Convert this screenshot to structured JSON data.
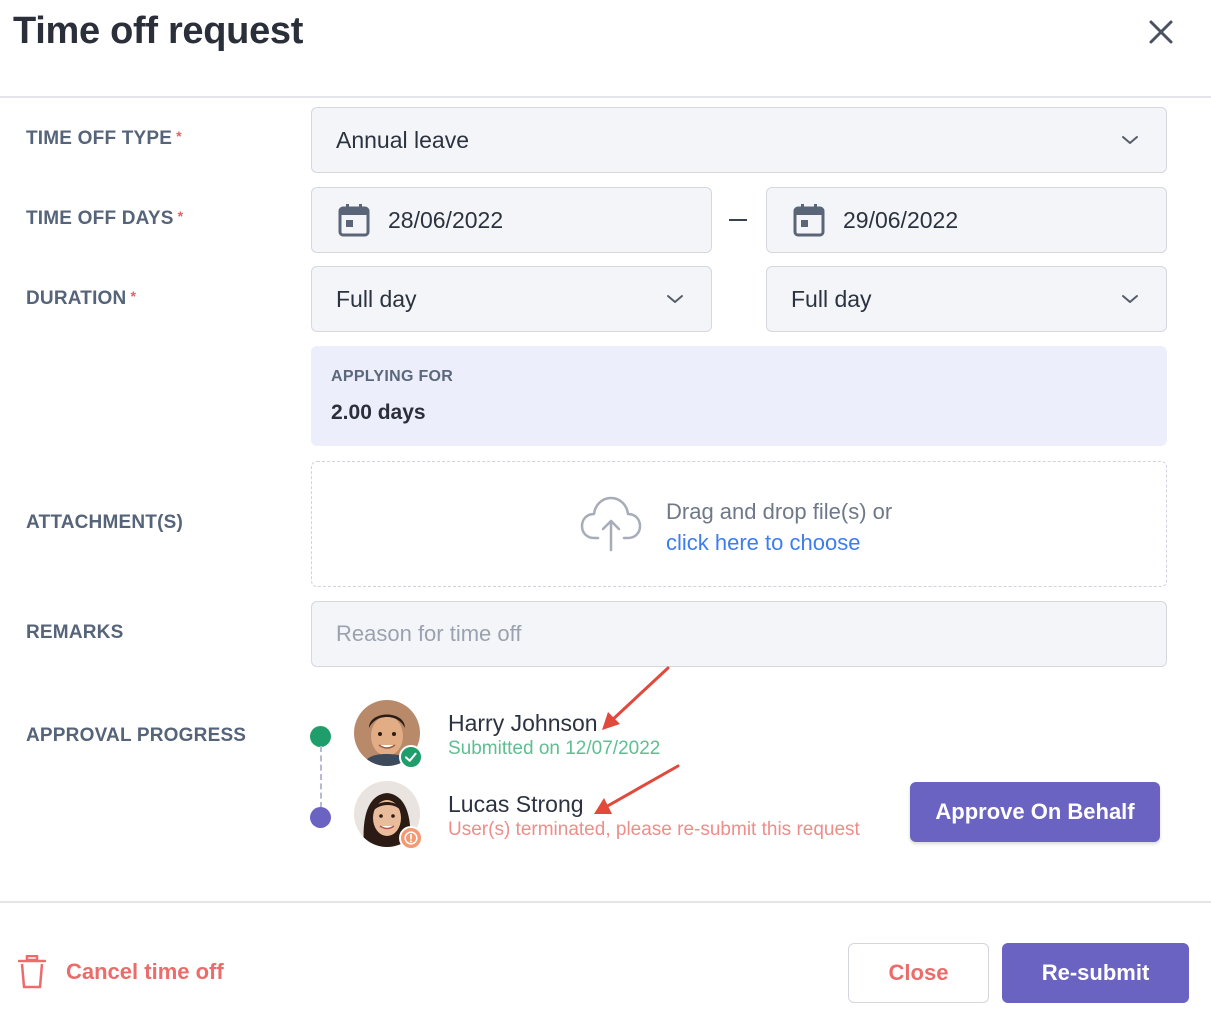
{
  "dialog": {
    "title": "Time off request"
  },
  "fields": {
    "time_off_type": {
      "label": "TIME OFF TYPE",
      "required_mark": "*",
      "value": "Annual leave"
    },
    "time_off_days": {
      "label": "TIME OFF DAYS",
      "required_mark": "*",
      "start_date": "28/06/2022",
      "end_date": "29/06/2022"
    },
    "duration": {
      "label": "DURATION",
      "required_mark": "*",
      "start_value": "Full day",
      "end_value": "Full day"
    },
    "applying_for": {
      "label": "APPLYING FOR",
      "value": "2.00 days"
    },
    "attachments": {
      "label": "ATTACHMENT(S)",
      "drop_text": "Drag and drop file(s) or",
      "link_text": "click here to choose"
    },
    "remarks": {
      "label": "REMARKS",
      "placeholder": "Reason for time off"
    }
  },
  "approval": {
    "label": "APPROVAL PROGRESS",
    "approvers": [
      {
        "name": "Harry Johnson",
        "status_text": "Submitted on 12/07/2022",
        "status_color": "#5dbf92",
        "dot_color": "#1f9d6b",
        "badge": "check-icon"
      },
      {
        "name": "Lucas Strong",
        "status_text": "User(s) terminated, please re-submit this request",
        "status_color": "#ef8d8a",
        "dot_color": "#6a63c2",
        "badge": "warning-icon"
      }
    ],
    "approve_button": "Approve On Behalf"
  },
  "footer": {
    "cancel_label": "Cancel time off",
    "close_label": "Close",
    "resubmit_label": "Re-submit"
  },
  "colors": {
    "primary": "#6a63c2",
    "danger": "#ec6b6b",
    "link": "#3d7df0",
    "annotation_arrow": "#e0493c"
  }
}
